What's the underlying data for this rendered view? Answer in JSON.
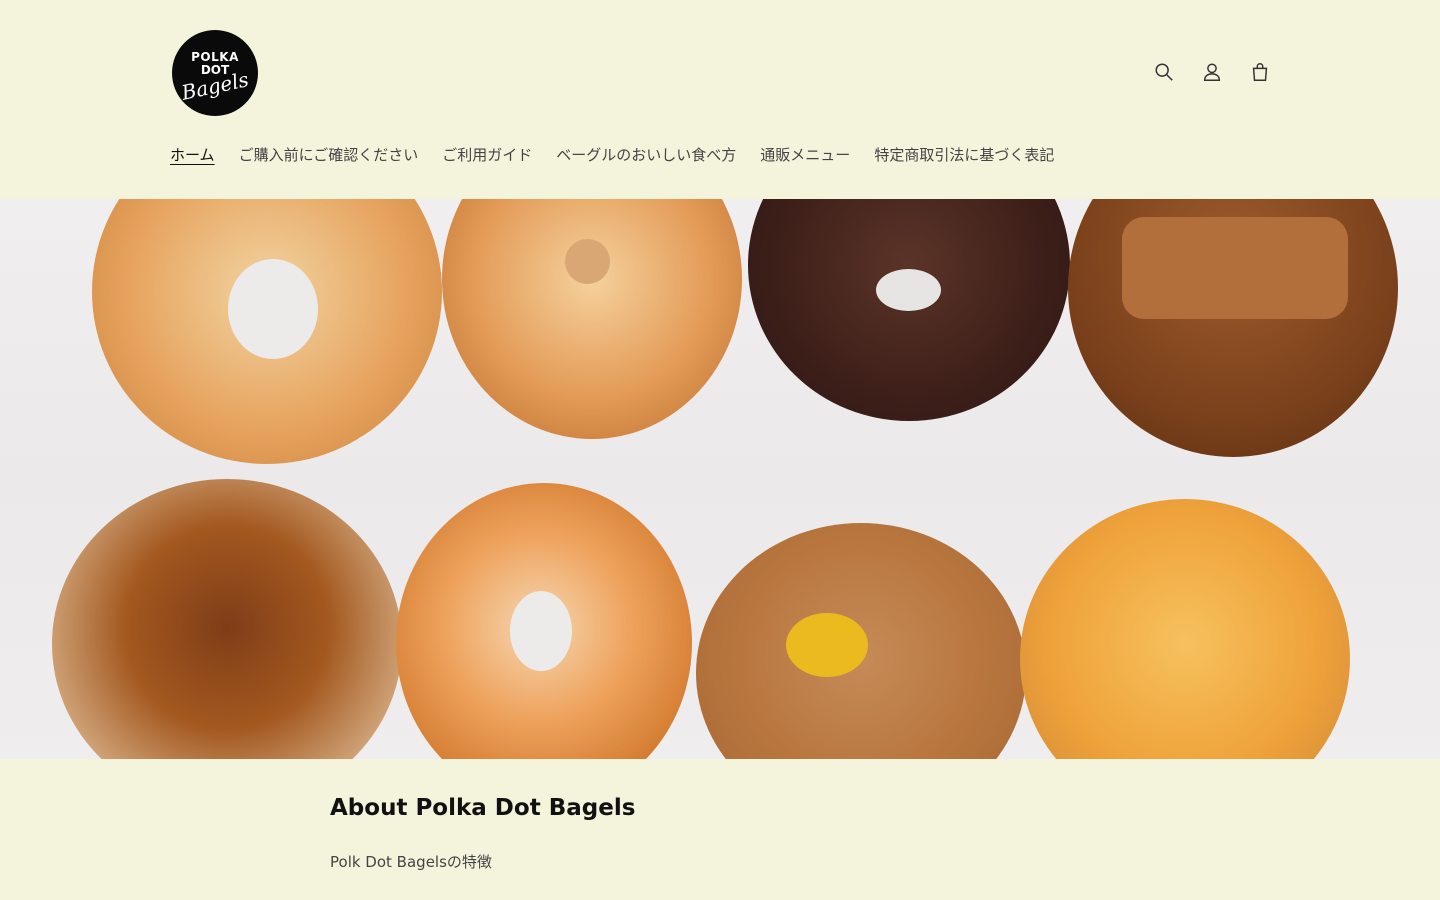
{
  "brand": {
    "logo_line1": "POLKA",
    "logo_line2": "DOT",
    "logo_line3": "Bagels"
  },
  "header_icons": [
    "search-icon",
    "account-icon",
    "cart-icon"
  ],
  "nav": {
    "items": [
      {
        "label": "ホーム",
        "active": true
      },
      {
        "label": "ご購入前にご確認ください",
        "active": false
      },
      {
        "label": "ご利用ガイド",
        "active": false
      },
      {
        "label": "ベーグルのおいしい食べ方",
        "active": false
      },
      {
        "label": "通販メニュー",
        "active": false
      },
      {
        "label": "特定商取引法に基づく表記",
        "active": false
      }
    ]
  },
  "about": {
    "title": "About Polka Dot Bagels",
    "feature": "Polk Dot Bagelsの特徴"
  },
  "colors": {
    "background": "#f4f4dd",
    "text": "#222222",
    "logo_bg": "#0a0a0a"
  }
}
